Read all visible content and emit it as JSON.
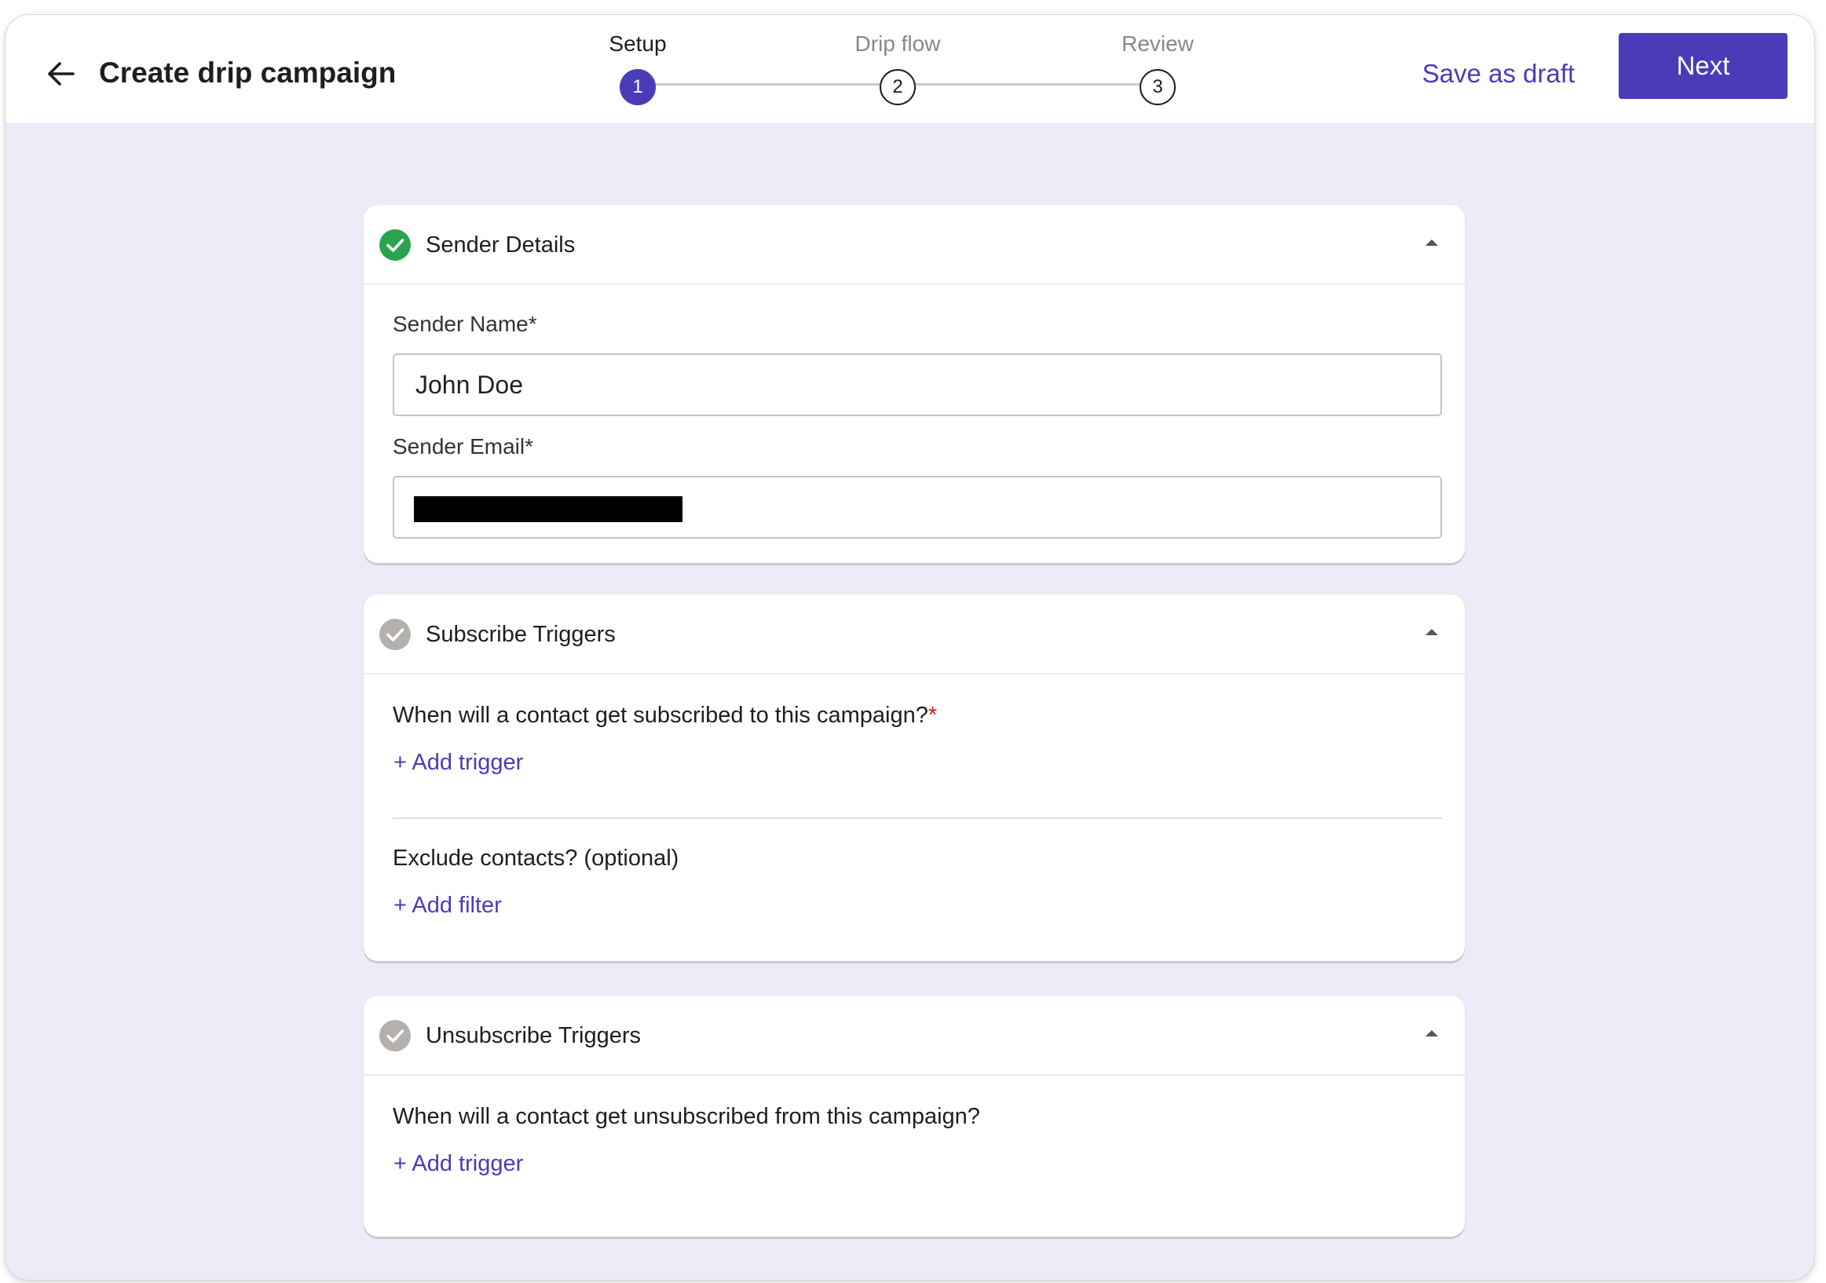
{
  "header": {
    "title": "Create drip campaign",
    "save_draft_label": "Save as draft",
    "next_label": "Next"
  },
  "stepper": {
    "steps": [
      {
        "label": "Setup",
        "number": "1",
        "state": "active"
      },
      {
        "label": "Drip flow",
        "number": "2",
        "state": "pending"
      },
      {
        "label": "Review",
        "number": "3",
        "state": "pending"
      }
    ]
  },
  "sections": {
    "sender": {
      "title": "Sender Details",
      "status": "complete",
      "name_label": "Sender Name*",
      "name_value": "John Doe",
      "email_label": "Sender Email*",
      "email_value": "[redacted]"
    },
    "subscribe": {
      "title": "Subscribe Triggers",
      "status": "incomplete",
      "question": "When will a contact get subscribed to this campaign?",
      "required_mark": "*",
      "add_trigger_label": "+ Add trigger",
      "exclude_question": "Exclude contacts? (optional)",
      "add_filter_label": "+ Add filter"
    },
    "unsubscribe": {
      "title": "Unsubscribe Triggers",
      "status": "incomplete",
      "question": "When will a contact get unsubscribed from this campaign?",
      "add_trigger_label": "+ Add trigger"
    }
  },
  "colors": {
    "accent": "#4a3cb8",
    "complete": "#2aa44f",
    "incomplete": "#b3b0ad",
    "background": "#edebf8",
    "required": "#d11a2a"
  },
  "icons": {
    "back": "arrow-left-icon",
    "complete": "check-circle-icon",
    "collapse": "caret-up-icon"
  }
}
